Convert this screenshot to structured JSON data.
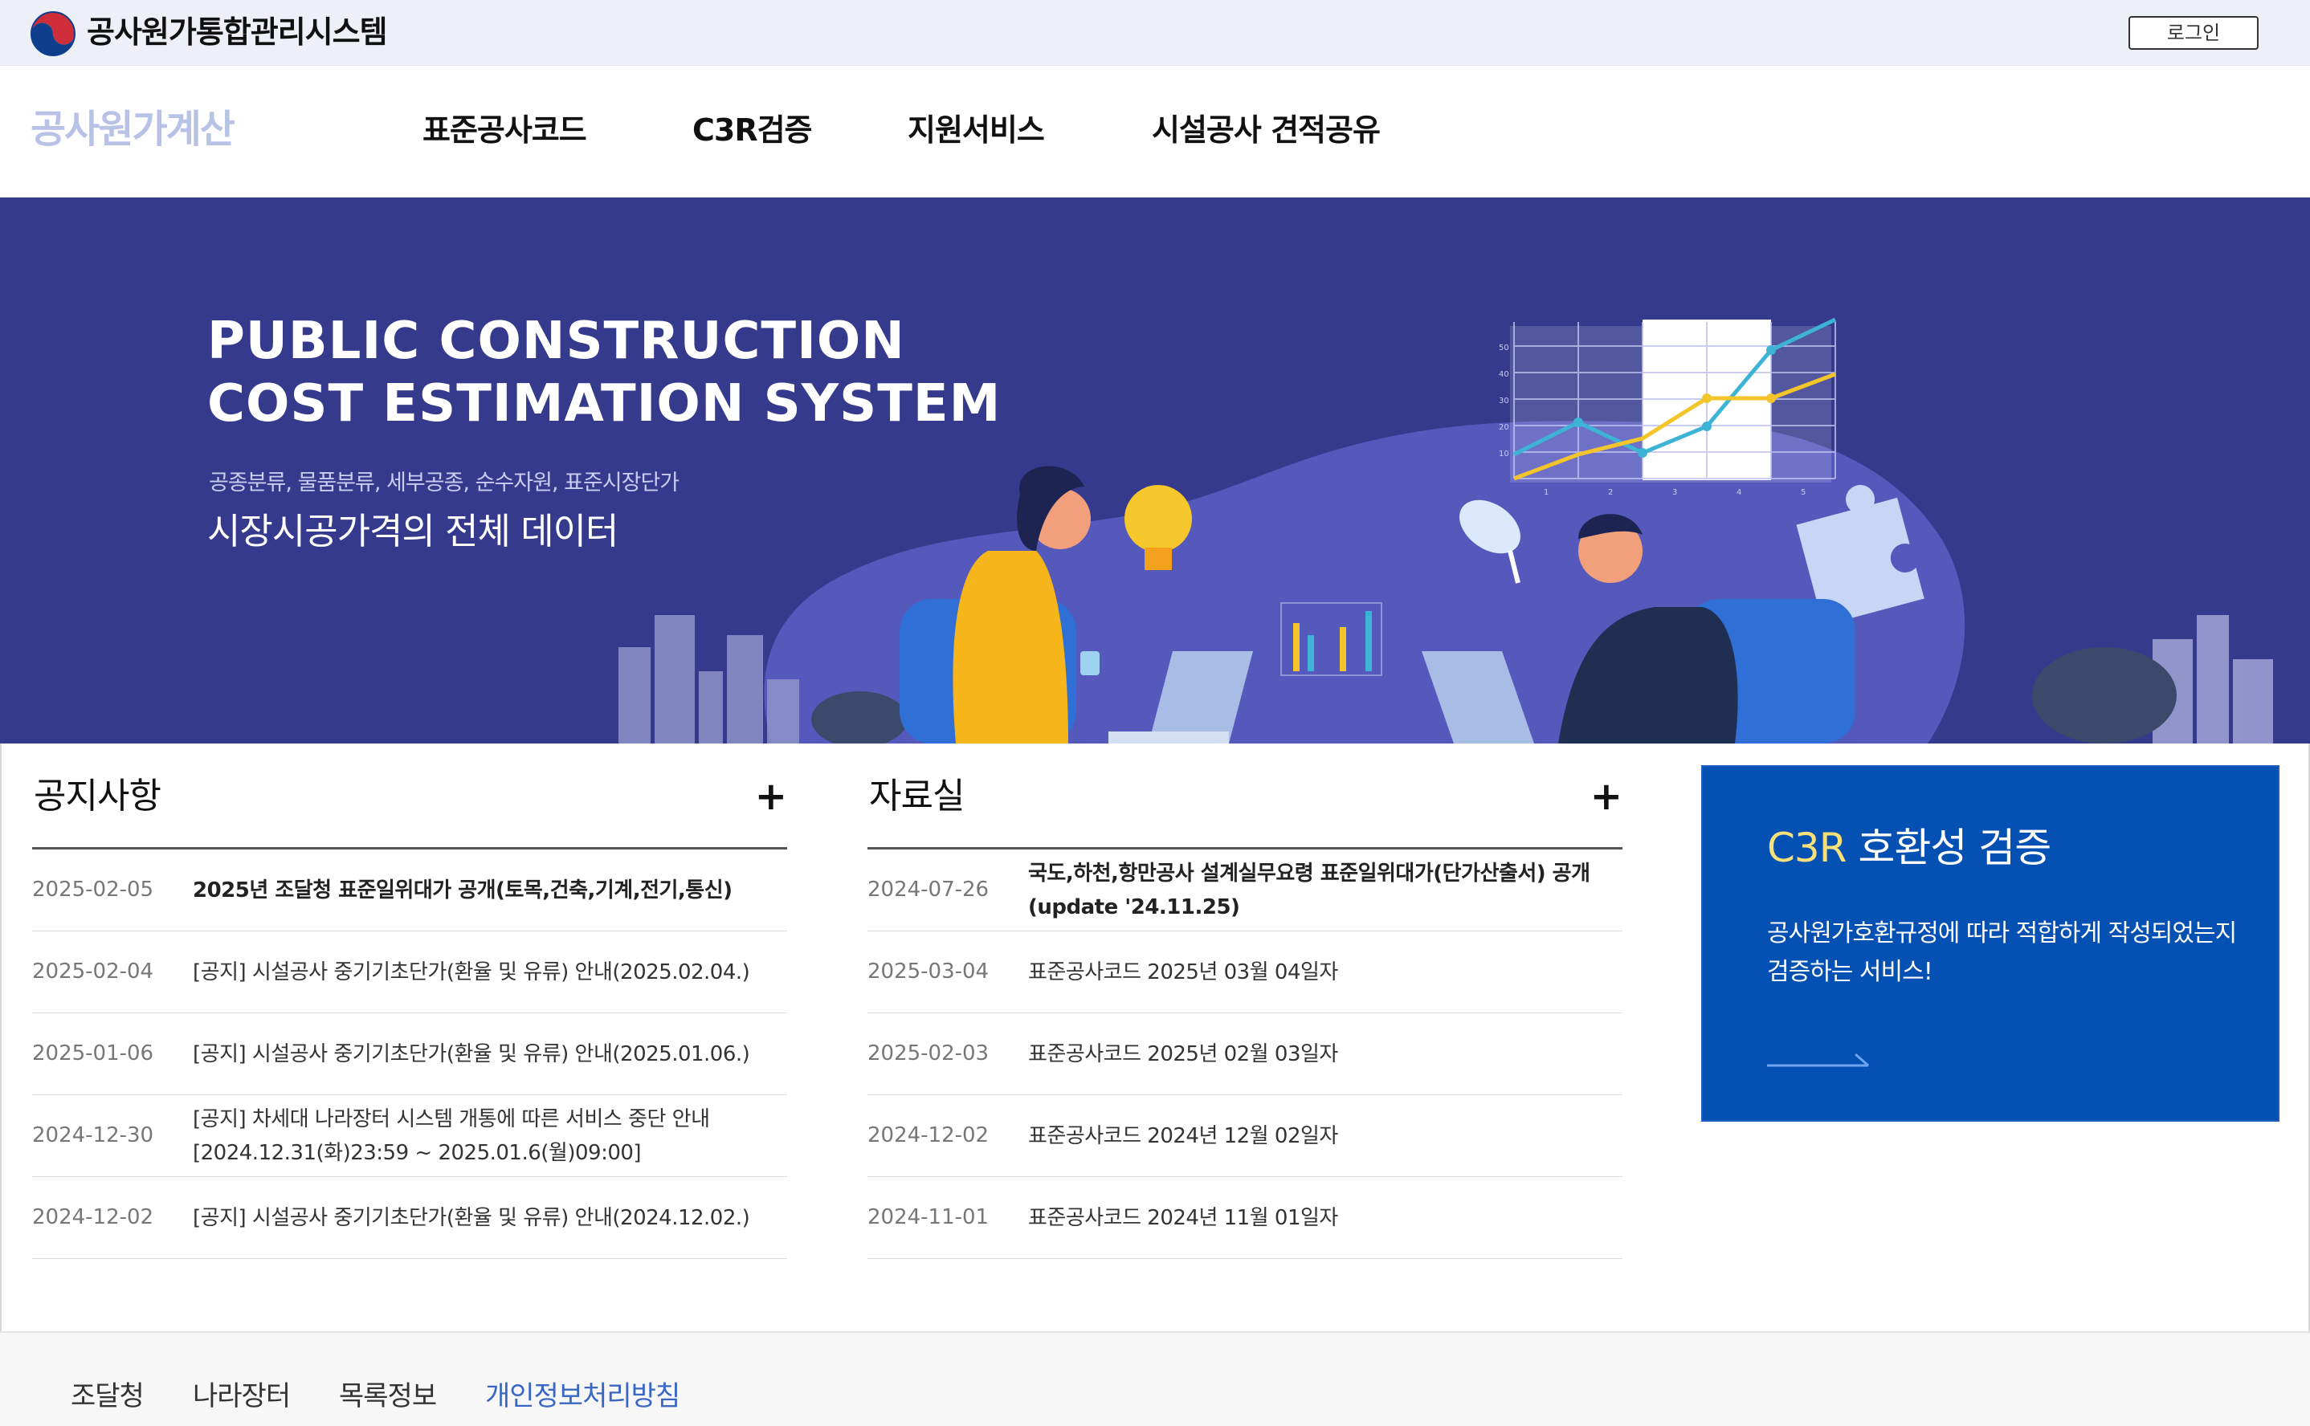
{
  "topbar": {
    "site_title": "공사원가통합관리시스템",
    "login_label": "로그인"
  },
  "nav": {
    "brand": "공사원가계산",
    "items": [
      {
        "label": "표준공사코드"
      },
      {
        "label": "C3R검증"
      },
      {
        "label": "지원서비스"
      },
      {
        "label": "시설공사 견적공유"
      }
    ]
  },
  "hero": {
    "title_line1": "PUBLIC CONSTRUCTION",
    "title_line2": "COST ESTIMATION SYSTEM",
    "subtitle": "공종분류, 물품분류, 세부공종, 순수자원, 표준시장단가",
    "headline": "시장시공가격의 전체 데이터",
    "chart_ticks_y": [
      "50",
      "40",
      "30",
      "20",
      "10"
    ],
    "chart_ticks_x": [
      "1",
      "2",
      "3",
      "4",
      "5"
    ]
  },
  "notices": {
    "title": "공지사항",
    "more_label": "+",
    "rows": [
      {
        "date": "2025-02-05",
        "title": "2025년 조달청 표준일위대가 공개(토목,건축,기계,전기,통신)"
      },
      {
        "date": "2025-02-04",
        "title": "[공지] 시설공사 중기기초단가(환율 및 유류) 안내(2025.02.04.)"
      },
      {
        "date": "2025-01-06",
        "title": "[공지] 시설공사 중기기초단가(환율 및 유류) 안내(2025.01.06.)"
      },
      {
        "date": "2024-12-30",
        "title": "[공지] 차세대 나라장터 시스템 개통에 따른 서비스 중단 안내 [2024.12.31(화)23:59 ~ 2025.01.6(월)09:00]"
      },
      {
        "date": "2024-12-02",
        "title": "[공지] 시설공사 중기기초단가(환율 및 유류) 안내(2024.12.02.)"
      }
    ]
  },
  "archive": {
    "title": "자료실",
    "more_label": "+",
    "rows": [
      {
        "date": "2024-07-26",
        "title": "국도,하천,항만공사 설계실무요령 표준일위대가(단가산출서) 공개 (update '24.11.25)"
      },
      {
        "date": "2025-03-04",
        "title": "표준공사코드 2025년 03월 04일자"
      },
      {
        "date": "2025-02-03",
        "title": "표준공사코드 2025년 02월 03일자"
      },
      {
        "date": "2024-12-02",
        "title": "표준공사코드 2024년 12월 02일자"
      },
      {
        "date": "2024-11-01",
        "title": "표준공사코드 2024년 11월 01일자"
      }
    ]
  },
  "c3r_card": {
    "title_highlight": "C3R",
    "title_rest": " 호환성 검증",
    "description": "공사원가호환규정에 따라 적합하게 작성되었는지 검증하는 서비스!",
    "colors": {
      "background": "#0451b3",
      "highlight": "#f7e07a"
    }
  },
  "footer": {
    "links": [
      {
        "label": "조달청"
      },
      {
        "label": "나라장터"
      },
      {
        "label": "목록정보"
      },
      {
        "label": "개인정보처리방침"
      }
    ]
  }
}
